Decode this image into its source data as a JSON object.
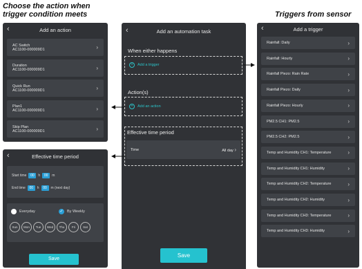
{
  "captions": {
    "left_line1": "Choose the action when",
    "left_line2": "trigger condition meets",
    "right": "Triggers from sensor"
  },
  "add_action": {
    "title": "Add an action",
    "items": [
      {
        "name": "AC Switch",
        "id": "AC1100-000009D1"
      },
      {
        "name": "Duration",
        "id": "AC1100-000009D1"
      },
      {
        "name": "Quick Run",
        "id": "AC1100-000009D1"
      },
      {
        "name": "Plan1",
        "id": "AC1100-000009D1"
      },
      {
        "name": "Skip Plan",
        "id": "AC1100-000009D1"
      }
    ]
  },
  "effective_period": {
    "title": "Effective time period",
    "start_label": "Start time",
    "end_label": "End time",
    "start_h": "00",
    "start_m": "00",
    "end_h": "00",
    "end_m": "00",
    "h_unit": "h",
    "m_unit": "m",
    "m_next_day": "m (next day)",
    "everyday": "Everyday",
    "by_weekly": "By Weekly",
    "days": [
      "Sun",
      "Mon",
      "Tue",
      "Wed",
      "Thu",
      "Fri",
      "Sat"
    ],
    "save": "Save"
  },
  "automation": {
    "title": "Add an automation task",
    "when_label": "When either happens",
    "add_trigger": "Add a trigger",
    "actions_label": "Action(s)",
    "add_action": "Add an action",
    "period_label": "Effective time period",
    "time_label": "Time",
    "time_value": "All day",
    "save": "Save"
  },
  "triggers": {
    "title": "Add a trigger",
    "items": [
      "Rainfall: Daily",
      "Rainfall: Hourly",
      "Rainfall Piezo: Rain Rate",
      "Rainfall Piezo: Daily",
      "Rainfall Piezo: Hourly",
      "PM2.5 CH1: PM2.5",
      "PM2.5 CH2: PM2.5",
      "Temp and Humidity CH1: Temperature",
      "Temp and Humidity CH1: Humidity",
      "Temp and Humidity CH2: Temperature",
      "Temp and Humidity CH2: Humidity",
      "Temp and Humidity CH3: Temperature",
      "Temp and Humidity CH3: Humidity"
    ]
  },
  "colors": {
    "accent": "#25c2cf",
    "panel": "#303236",
    "card": "#3f4247"
  }
}
